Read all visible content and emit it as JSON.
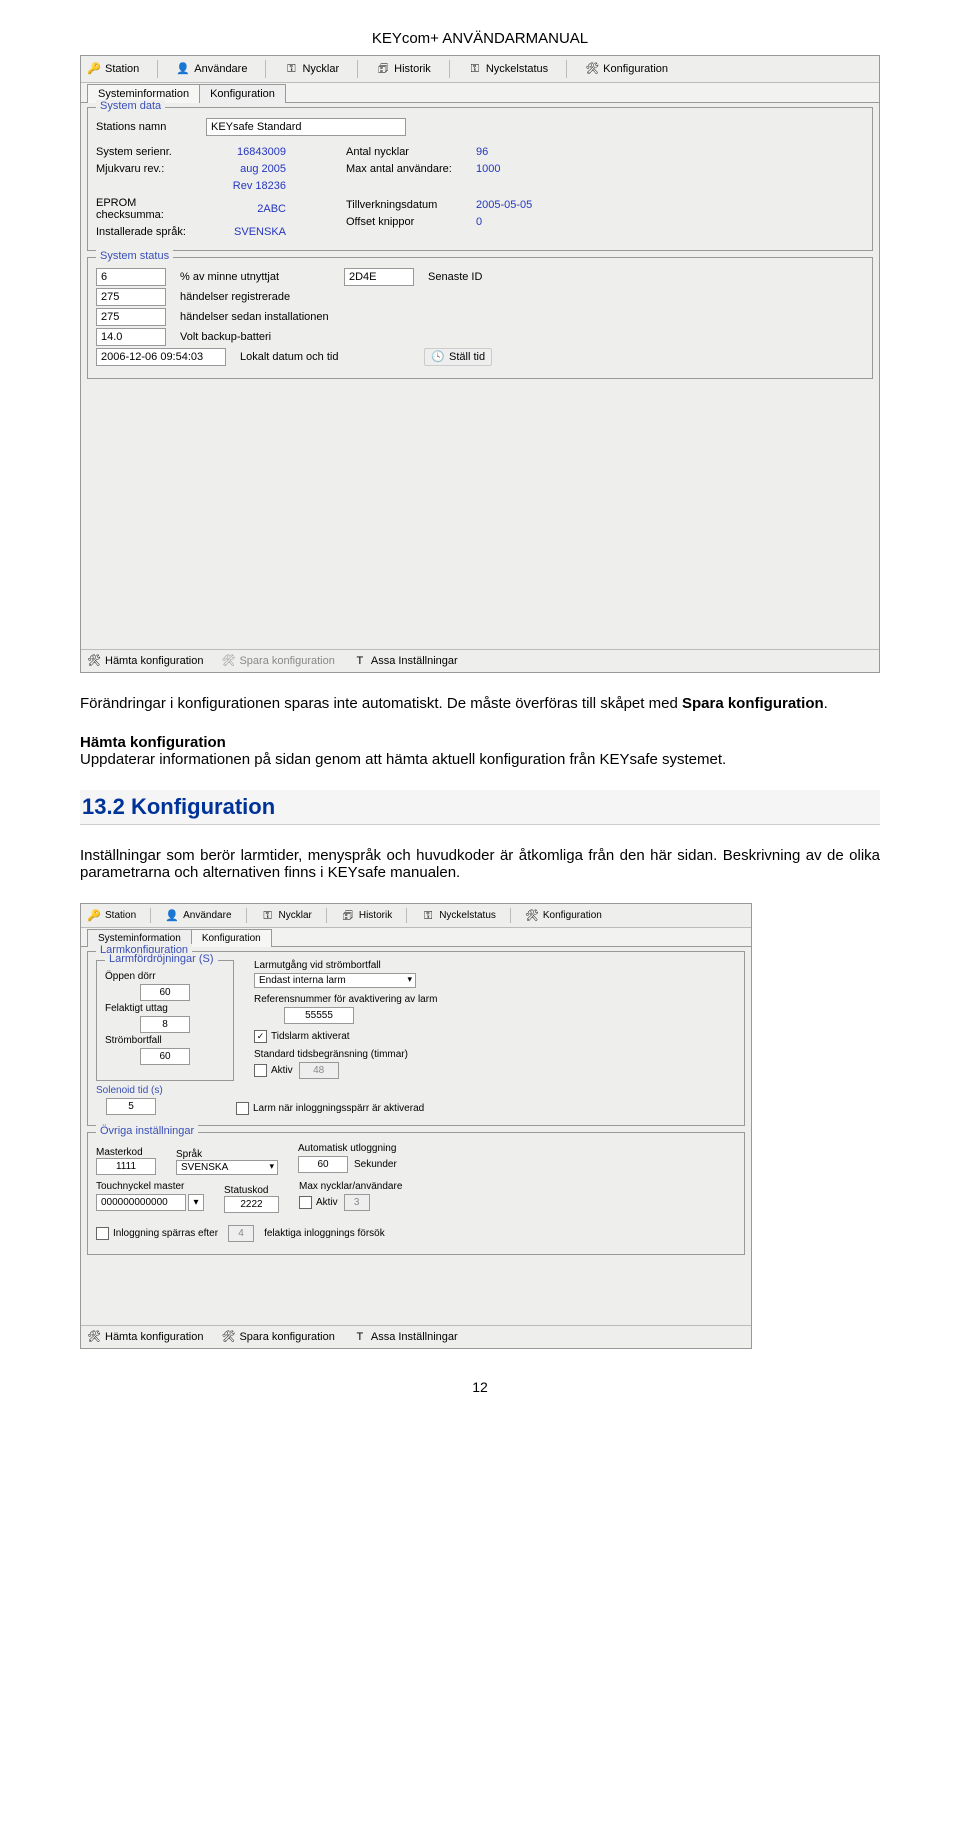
{
  "doc": {
    "title": "KEYcom+ ANVÄNDARMANUAL",
    "page_number": "12"
  },
  "window1": {
    "toolbar": {
      "station": "Station",
      "anvandare": "Användare",
      "nycklar": "Nycklar",
      "historik": "Historik",
      "nyckelstatus": "Nyckelstatus",
      "konfiguration": "Konfiguration"
    },
    "subtabs": {
      "sys": "Systeminformation",
      "konf": "Konfiguration"
    },
    "systemdata": {
      "legend": "System data",
      "stations_namn_l": "Stations namn",
      "stations_namn_v": "KEYsafe Standard",
      "system_serienr_l": "System serienr.",
      "system_serienr_v": "16843009",
      "mjukvaru_rev_l": "Mjukvaru rev.:",
      "mjukvaru_rev_v1": "aug 2005",
      "mjukvaru_rev_v2": "Rev 18236",
      "eprom_l": "EPROM checksumma:",
      "eprom_v": "2ABC",
      "installerade_l": "Installerade språk:",
      "installerade_v": "SVENSKA",
      "antal_nycklar_l": "Antal nycklar",
      "antal_nycklar_v": "96",
      "max_anvandare_l": "Max antal användare:",
      "max_anvandare_v": "1000",
      "tillverk_l": "Tillverkningsdatum",
      "tillverk_v": "2005-05-05",
      "offset_l": "Offset knippor",
      "offset_v": "0"
    },
    "systemstatus": {
      "legend": "System status",
      "minne_v": "6",
      "minne_l": "% av minne utnyttjat",
      "senaste_v": "2D4E",
      "senaste_l": "Senaste ID",
      "handelser_reg_v": "275",
      "handelser_reg_l": "händelser registrerade",
      "handelser_inst_v": "275",
      "handelser_inst_l": "händelser sedan installationen",
      "volt_v": "14.0",
      "volt_l": "Volt backup-batteri",
      "datum_v": "2006-12-06 09:54:03",
      "datum_l": "Lokalt datum och tid",
      "stall_tid": "Ställ tid"
    },
    "bottombar": {
      "hamta": "Hämta konfiguration",
      "spara": "Spara konfiguration",
      "assa": "Assa Inställningar"
    }
  },
  "body": {
    "p1a": "Förändringar i konfigurationen sparas inte automatiskt. De måste överföras till skåpet med ",
    "p1b": "Spara konfiguration",
    "p1c": ".",
    "h1": "Hämta konfiguration",
    "p2": "Uppdaterar informationen på sidan genom att hämta aktuell konfiguration från KEYsafe systemet.",
    "section_num": "13.2 ",
    "section_title": "Konfiguration",
    "p3": "Inställningar som berör larmtider, menyspråk och huvudkoder är åtkomliga från den här sidan. Beskrivning av de olika parametrarna och alternativen finns i KEYsafe manualen."
  },
  "window2": {
    "toolbar": {
      "station": "Station",
      "anvandare": "Användare",
      "nycklar": "Nycklar",
      "historik": "Historik",
      "nyckelstatus": "Nyckelstatus",
      "konfiguration": "Konfiguration"
    },
    "subtabs": {
      "sys": "Systeminformation",
      "konf": "Konfiguration"
    },
    "larmkonfig": {
      "legend": "Larmkonfiguration",
      "larmford_legend": "Larmfördröjningar (S)",
      "oppen_l": "Öppen dörr",
      "oppen_v": "60",
      "felaktigt_l": "Felaktigt uttag",
      "felaktigt_v": "8",
      "strombortfall_l": "Strömbortfall",
      "strombortfall_v": "60",
      "solenoid_l": "Solenoid tid (s)",
      "solenoid_v": "5",
      "larmutgang_l": "Larmutgång vid strömbortfall",
      "larmutgang_v": "Endast interna larm",
      "refnr_l": "Referensnummer för avaktivering av larm",
      "refnr_v": "55555",
      "tidslarm_l": "Tidslarm aktiverat",
      "std_tid_l": "Standard tidsbegränsning (timmar)",
      "aktiv_l": "Aktiv",
      "aktiv_v": "48",
      "larm_inlogg_l": "Larm när inloggningsspärr är aktiverad"
    },
    "ovriga": {
      "legend": "Övriga inställningar",
      "masterkod_l": "Masterkod",
      "masterkod_v": "1111",
      "sprak_l": "Språk",
      "sprak_v": "SVENSKA",
      "auto_l": "Automatisk utloggning",
      "auto_v": "60",
      "sekunder": "Sekunder",
      "touch_l": "Touchnyckel master",
      "touch_v": "000000000000",
      "statuskod_l": "Statuskod",
      "statuskod_v": "2222",
      "max_nyck_l": "Max nycklar/användare",
      "max_nyck_aktiv": "Aktiv",
      "max_nyck_v": "3",
      "inlogg_l": "Inloggning spärras efter",
      "inlogg_v": "4",
      "inlogg_suffix": "felaktiga inloggnings försök"
    },
    "bottombar": {
      "hamta": "Hämta konfiguration",
      "spara": "Spara konfiguration",
      "assa": "Assa Inställningar"
    }
  }
}
